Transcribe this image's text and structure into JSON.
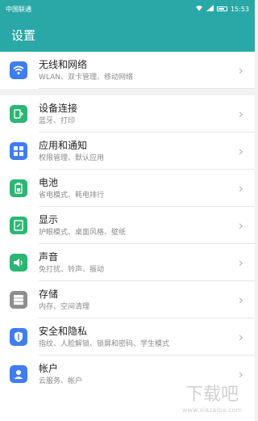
{
  "statusbar": {
    "carrier": "中国联通",
    "time": "15:53"
  },
  "appbar": {
    "title": "设置"
  },
  "items": [
    {
      "title": "无线和网络",
      "subtitle": "WLAN、双卡管理、移动网络",
      "icon": "wifi-icon",
      "color": "#3f7df0"
    },
    {
      "title": "设备连接",
      "subtitle": "蓝牙、打印",
      "icon": "device-connect-icon",
      "color": "#2bb673"
    },
    {
      "title": "应用和通知",
      "subtitle": "权限管理、默认应用",
      "icon": "apps-icon",
      "color": "#3f7df0"
    },
    {
      "title": "电池",
      "subtitle": "省电模式、耗电排行",
      "icon": "battery-icon",
      "color": "#2bb673"
    },
    {
      "title": "显示",
      "subtitle": "护眼模式、桌面风格、壁纸",
      "icon": "display-icon",
      "color": "#2bb673"
    },
    {
      "title": "声音",
      "subtitle": "免打扰、铃声、振动",
      "icon": "sound-icon",
      "color": "#2bb673"
    },
    {
      "title": "存储",
      "subtitle": "内存、空间清理",
      "icon": "storage-icon",
      "color": "#8e8e8e"
    },
    {
      "title": "安全和隐私",
      "subtitle": "指纹、人脸解锁、锁屏和密码、学生模式",
      "icon": "shield-icon",
      "color": "#3f7df0"
    },
    {
      "title": "帐户",
      "subtitle": "云服务、帐户",
      "icon": "account-icon",
      "color": "#3f7df0"
    }
  ],
  "watermark": {
    "text": "www.xiazaiba.com"
  }
}
